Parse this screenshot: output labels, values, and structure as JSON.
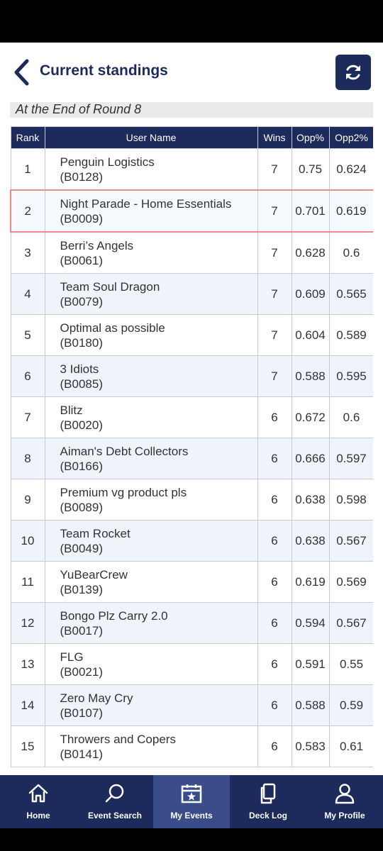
{
  "header": {
    "title": "Current standings"
  },
  "subheader": "At the End of Round 8",
  "table": {
    "columns": [
      "Rank",
      "User Name",
      "Wins",
      "Opp%",
      "Opp2%"
    ],
    "rows": [
      {
        "rank": "1",
        "name": "Penguin Logistics",
        "id": "(B0128)",
        "wins": "7",
        "opp": "0.75",
        "opp2": "0.624"
      },
      {
        "rank": "2",
        "name": "Night Parade - Home Essentials",
        "id": "(B0009)",
        "wins": "7",
        "opp": "0.701",
        "opp2": "0.619"
      },
      {
        "rank": "3",
        "name": "Berri’s Angels",
        "id": "(B0061)",
        "wins": "7",
        "opp": "0.628",
        "opp2": "0.6"
      },
      {
        "rank": "4",
        "name": "Team Soul Dragon",
        "id": "(B0079)",
        "wins": "7",
        "opp": "0.609",
        "opp2": "0.565"
      },
      {
        "rank": "5",
        "name": "Optimal as possible",
        "id": "(B0180)",
        "wins": "7",
        "opp": "0.604",
        "opp2": "0.589"
      },
      {
        "rank": "6",
        "name": "3 Idiots",
        "id": "(B0085)",
        "wins": "7",
        "opp": "0.588",
        "opp2": "0.595"
      },
      {
        "rank": "7",
        "name": "Blitz",
        "id": "(B0020)",
        "wins": "6",
        "opp": "0.672",
        "opp2": "0.6"
      },
      {
        "rank": "8",
        "name": "Aiman's Debt Collectors",
        "id": "(B0166)",
        "wins": "6",
        "opp": "0.666",
        "opp2": "0.597"
      },
      {
        "rank": "9",
        "name": "Premium vg product pls",
        "id": "(B0089)",
        "wins": "6",
        "opp": "0.638",
        "opp2": "0.598"
      },
      {
        "rank": "10",
        "name": "Team Rocket",
        "id": "(B0049)",
        "wins": "6",
        "opp": "0.638",
        "opp2": "0.567"
      },
      {
        "rank": "11",
        "name": "YuBearCrew",
        "id": "(B0139)",
        "wins": "6",
        "opp": "0.619",
        "opp2": "0.569"
      },
      {
        "rank": "12",
        "name": "Bongo Plz Carry 2.0",
        "id": "(B0017)",
        "wins": "6",
        "opp": "0.594",
        "opp2": "0.567"
      },
      {
        "rank": "13",
        "name": "FLG",
        "id": "(B0021)",
        "wins": "6",
        "opp": "0.591",
        "opp2": "0.55"
      },
      {
        "rank": "14",
        "name": "Zero May Cry",
        "id": "(B0107)",
        "wins": "6",
        "opp": "0.588",
        "opp2": "0.59"
      },
      {
        "rank": "15",
        "name": "Throwers and Copers",
        "id": "(B0141)",
        "wins": "6",
        "opp": "0.583",
        "opp2": "0.61"
      }
    ]
  },
  "nav": {
    "home": "Home",
    "event_search": "Event Search",
    "my_events": "My Events",
    "deck_log": "Deck Log",
    "my_profile": "My Profile"
  },
  "colors": {
    "primary": "#1d2a5c",
    "nav_active": "#3a4d8a",
    "highlight_border": "#e88a91",
    "row_alt": "#eff4fb"
  }
}
